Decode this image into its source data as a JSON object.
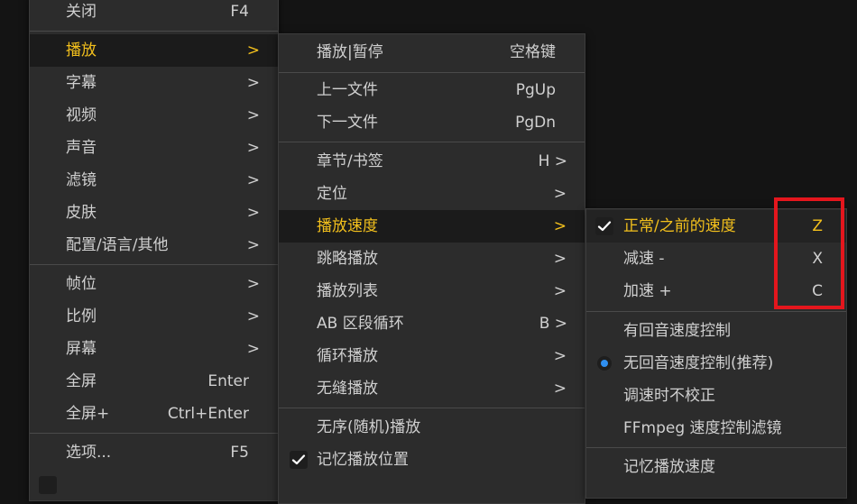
{
  "main_menu": {
    "close": {
      "label": "关闭",
      "shortcut": "F4"
    },
    "play": {
      "label": "播放",
      "arrow": ">"
    },
    "subtitle": {
      "label": "字幕",
      "arrow": ">"
    },
    "video": {
      "label": "视频",
      "arrow": ">"
    },
    "audio": {
      "label": "声音",
      "arrow": ">"
    },
    "filter": {
      "label": "滤镜",
      "arrow": ">"
    },
    "skin": {
      "label": "皮肤",
      "arrow": ">"
    },
    "config": {
      "label": "配置/语言/其他",
      "arrow": ">"
    },
    "frame": {
      "label": "帧位",
      "arrow": ">"
    },
    "ratio": {
      "label": "比例",
      "arrow": ">"
    },
    "screen": {
      "label": "屏幕",
      "arrow": ">"
    },
    "fullscreen": {
      "label": "全屏",
      "shortcut": "Enter"
    },
    "fullscreen_plus": {
      "label": "全屏+",
      "shortcut": "Ctrl+Enter"
    },
    "options": {
      "label": "选项...",
      "shortcut": "F5"
    }
  },
  "play_menu": {
    "play_pause": {
      "label": "播放|暂停",
      "shortcut": "空格键"
    },
    "prev_file": {
      "label": "上一文件",
      "shortcut": "PgUp"
    },
    "next_file": {
      "label": "下一文件",
      "shortcut": "PgDn"
    },
    "chapters": {
      "label": "章节/书签",
      "shortcut": "H >"
    },
    "seek": {
      "label": "定位",
      "arrow": ">"
    },
    "speed": {
      "label": "播放速度",
      "arrow": ">"
    },
    "skip_play": {
      "label": "跳略播放",
      "arrow": ">"
    },
    "playlist": {
      "label": "播放列表",
      "arrow": ">"
    },
    "ab_loop": {
      "label": "AB 区段循环",
      "shortcut": "B >"
    },
    "loop": {
      "label": "循环播放",
      "arrow": ">"
    },
    "gapless": {
      "label": "无缝播放",
      "arrow": ">"
    },
    "shuffle": {
      "label": "无序(随机)播放"
    },
    "remember_position": {
      "label": "记忆播放位置",
      "checked": true
    }
  },
  "speed_menu": {
    "normal": {
      "label": "正常/之前的速度",
      "shortcut": "Z",
      "checked": true
    },
    "slower": {
      "label": "减速 -",
      "shortcut": "X"
    },
    "faster": {
      "label": "加速 +",
      "shortcut": "C"
    },
    "echo_control": {
      "label": "有回音速度控制"
    },
    "no_echo_control": {
      "label": "无回音速度控制(推荐)",
      "selected": true
    },
    "no_correction": {
      "label": "调速时不校正"
    },
    "ffmpeg_filter": {
      "label": "FFmpeg 速度控制滤镜"
    },
    "remember_speed": {
      "label": "记忆播放速度"
    }
  },
  "colors": {
    "menu_bg": "#2c2c2c",
    "active_text": "#f3c01c",
    "text": "#d0d0d0",
    "highlight_box": "#e4161d",
    "radio_dot": "#2f8ff0"
  }
}
